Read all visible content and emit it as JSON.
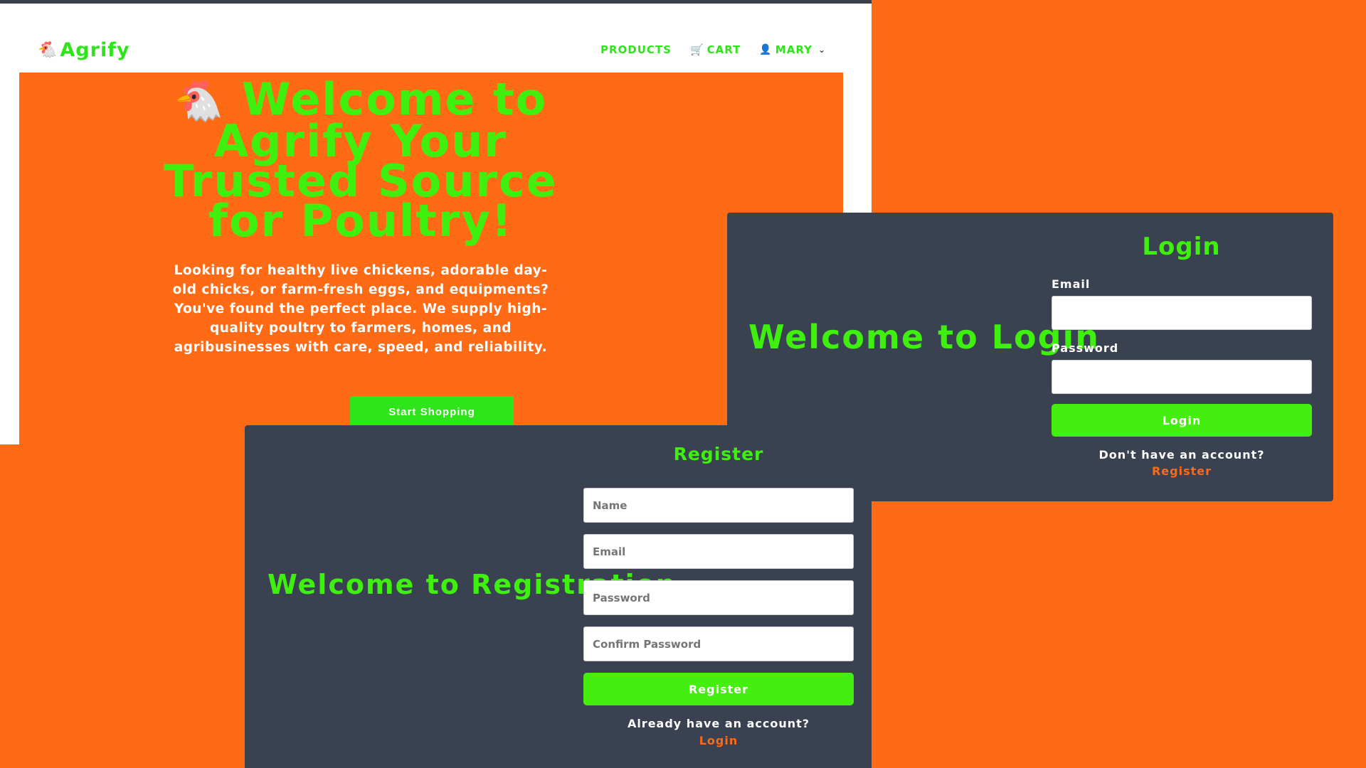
{
  "colors": {
    "accent": "#3ff00f",
    "background": "#ff6a14",
    "card": "#3a4252"
  },
  "navbar": {
    "brand_icon": "chicken-icon",
    "brand": "Agrify",
    "links": {
      "products": "PRODUCTS",
      "cart_icon": "cart-icon",
      "cart": "CART",
      "user_icon": "user-icon",
      "user": "MARY"
    }
  },
  "hero": {
    "icon": "chicken-icon",
    "title": "Welcome to Agrify Your Trusted Source for Poultry!",
    "text": "Looking for healthy live chickens, adorable day-old chicks, or farm-fresh eggs, and equipments? You've found the perfect place. We supply high-quality poultry to farmers, homes, and agribusinesses with care, speed, and reliability.",
    "button": "Start Shopping"
  },
  "login": {
    "welcome": "Welcome to Login",
    "title": "Login",
    "email_label": "Email",
    "password_label": "Password",
    "button": "Login",
    "switch_text": "Don't have an account?",
    "switch_link": "Register"
  },
  "register": {
    "welcome": "Welcome to Registration",
    "title": "Register",
    "name_placeholder": "Name",
    "email_placeholder": "Email",
    "password_placeholder": "Password",
    "confirm_placeholder": "Confirm Password",
    "button": "Register",
    "switch_text": "Already have an account?",
    "switch_link": "Login"
  }
}
